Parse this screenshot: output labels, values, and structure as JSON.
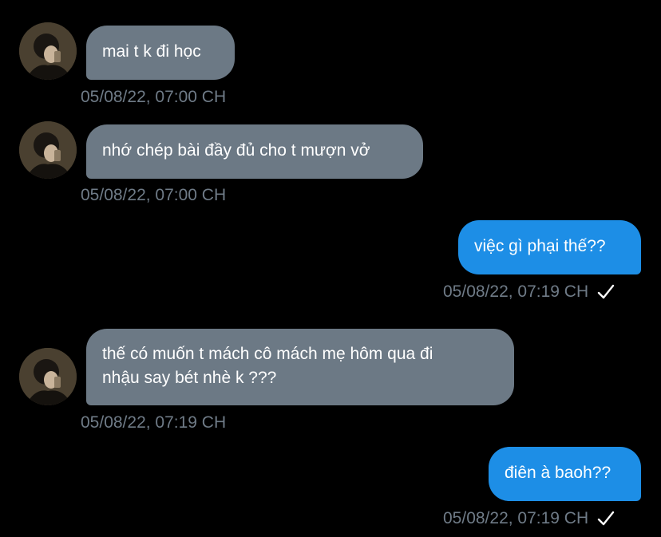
{
  "messages": [
    {
      "direction": "incoming",
      "text": "mai t k đi học",
      "timestamp": "05/08/22, 07:00 CH"
    },
    {
      "direction": "incoming",
      "text": "nhớ chép bài đầy đủ cho t mượn vở",
      "timestamp": "05/08/22, 07:00 CH"
    },
    {
      "direction": "outgoing",
      "text": "việc gì phại thế??",
      "timestamp": "05/08/22, 07:19 CH",
      "status_icon": "check-icon"
    },
    {
      "direction": "incoming",
      "lines": [
        "thế có muốn t mách cô mách mẹ hôm qua đi",
        "nhậu say bét nhè k ???"
      ],
      "timestamp": "05/08/22, 07:19 CH"
    },
    {
      "direction": "outgoing",
      "text": "điên à baoh??",
      "timestamp": "05/08/22, 07:19 CH",
      "status_icon": "check-icon"
    }
  ],
  "colors": {
    "background": "#000000",
    "incoming_bubble": "#6c7985",
    "outgoing_bubble": "#1d8ee6",
    "timestamp": "#6f7b87",
    "text": "#ffffff"
  }
}
